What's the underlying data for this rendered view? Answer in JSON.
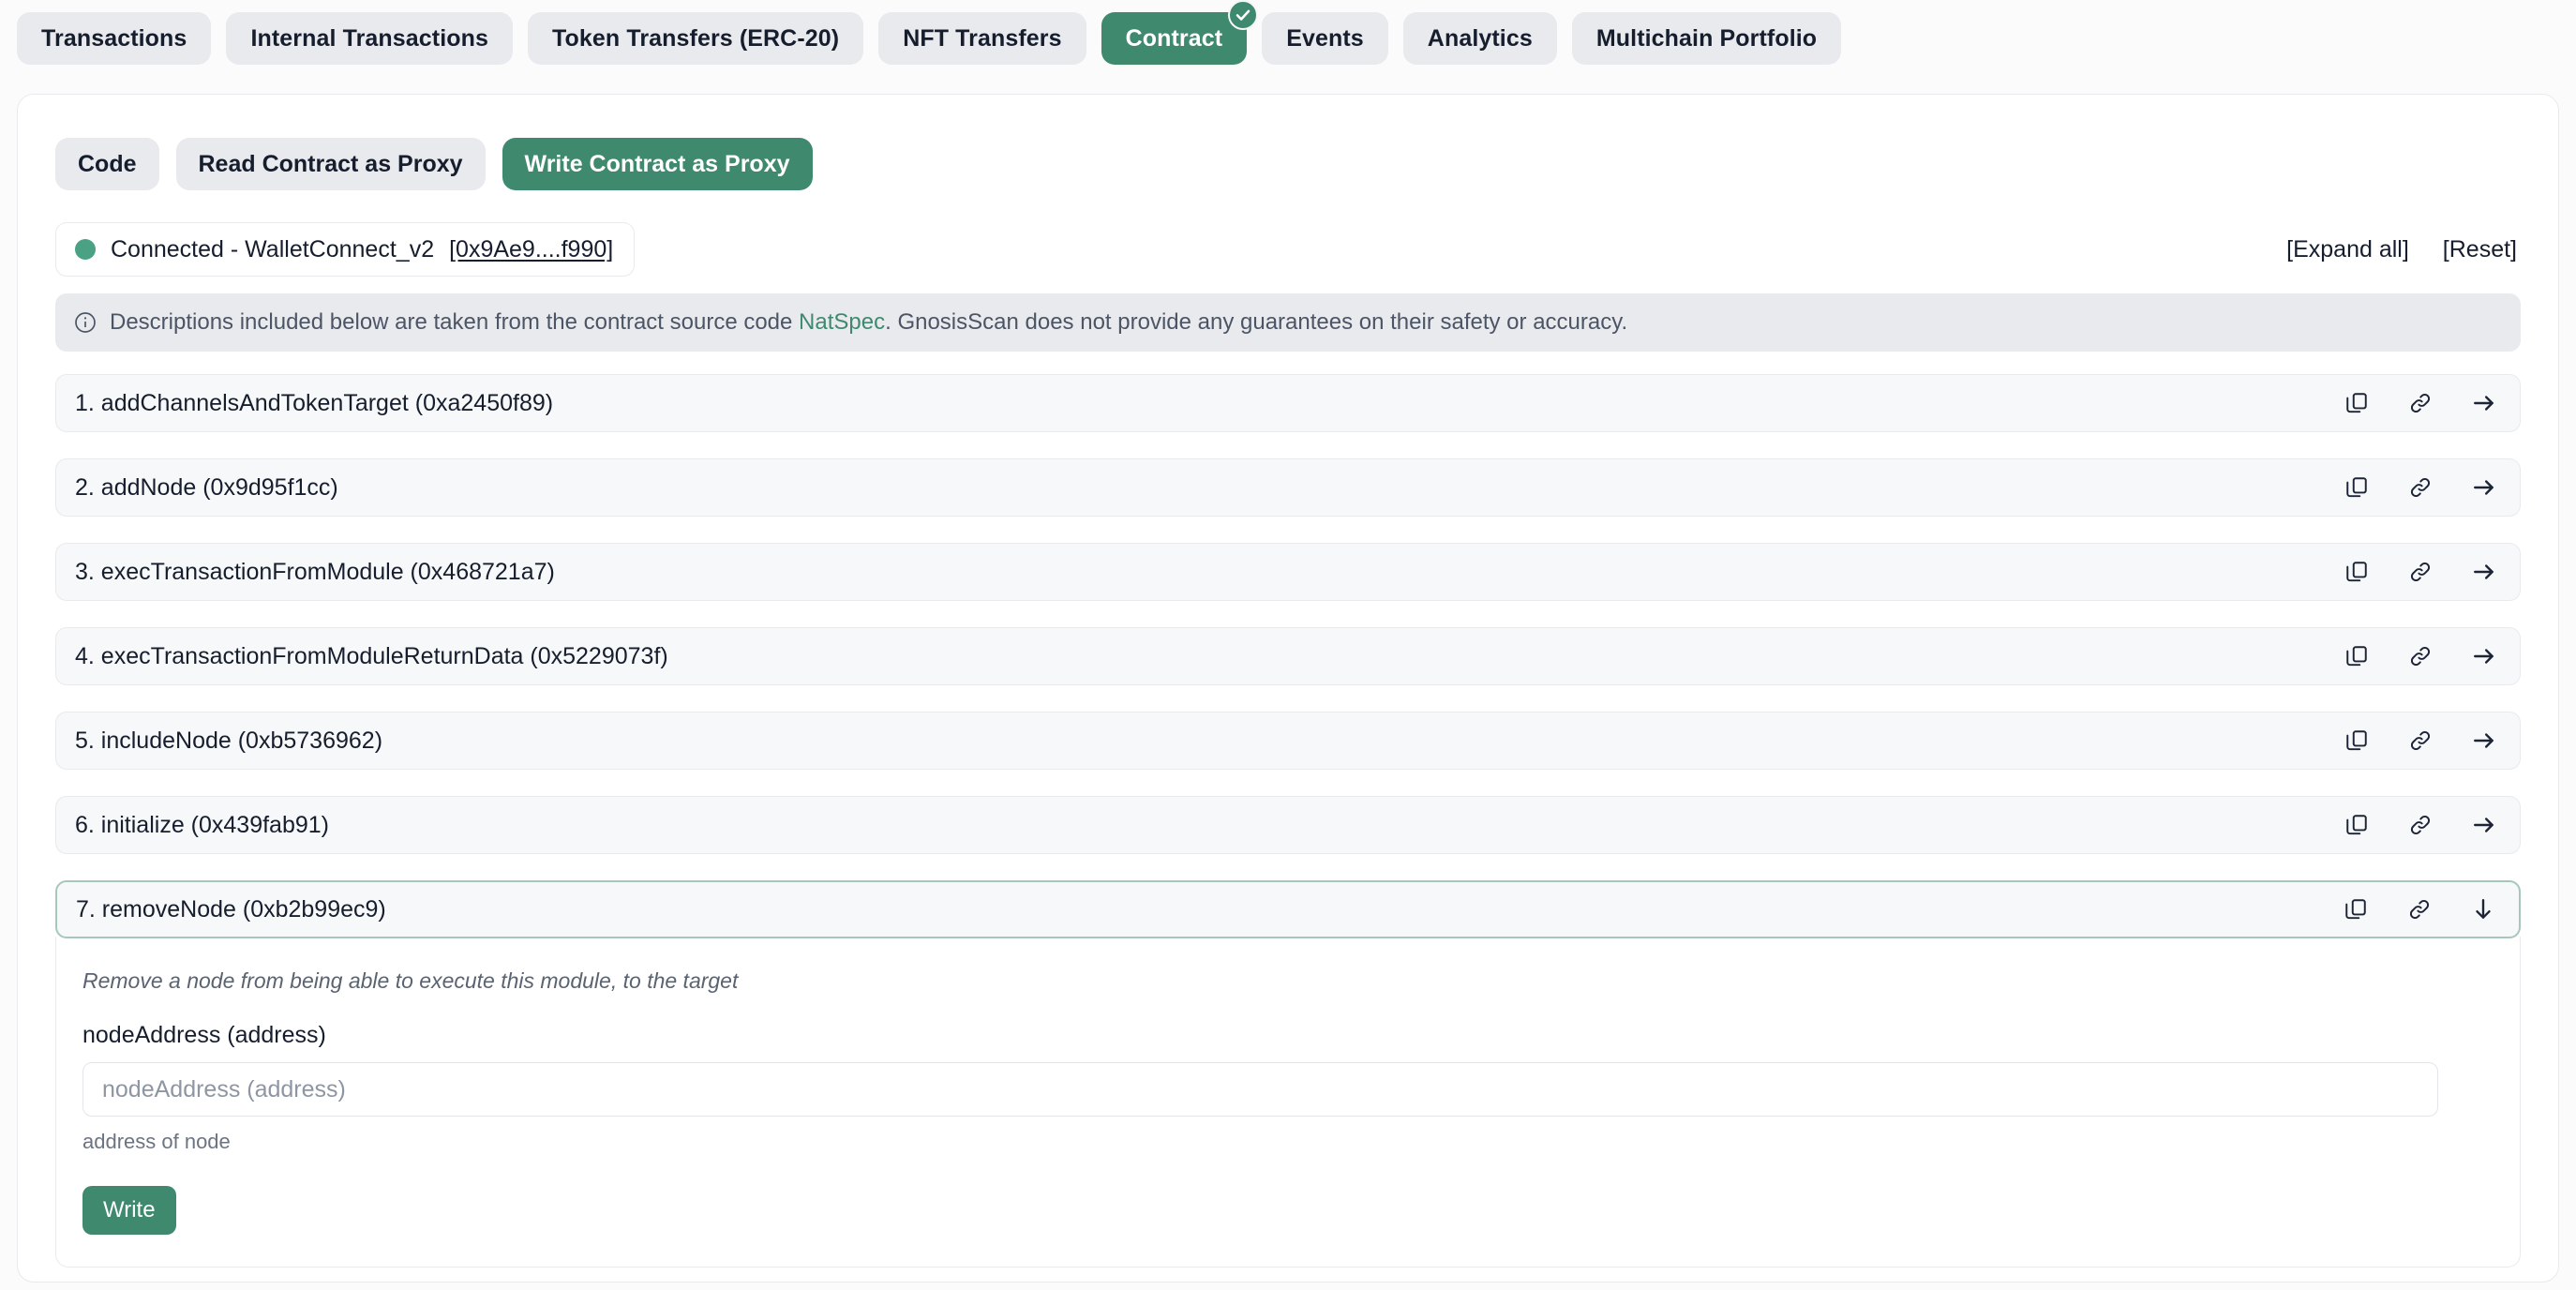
{
  "top_tabs": [
    {
      "label": "Transactions",
      "active": false,
      "badge": false
    },
    {
      "label": "Internal Transactions",
      "active": false,
      "badge": false
    },
    {
      "label": "Token Transfers (ERC-20)",
      "active": false,
      "badge": false
    },
    {
      "label": "NFT Transfers",
      "active": false,
      "badge": false
    },
    {
      "label": "Contract",
      "active": true,
      "badge": true
    },
    {
      "label": "Events",
      "active": false,
      "badge": false
    },
    {
      "label": "Analytics",
      "active": false,
      "badge": false
    },
    {
      "label": "Multichain Portfolio",
      "active": false,
      "badge": false
    }
  ],
  "sub_tabs": [
    {
      "label": "Code",
      "active": false
    },
    {
      "label": "Read Contract as Proxy",
      "active": false
    },
    {
      "label": "Write Contract as Proxy",
      "active": true
    }
  ],
  "wallet": {
    "status_text": "Connected - WalletConnect_v2",
    "address": "[0x9Ae9....f990]",
    "expand_all": "[Expand all]",
    "reset": "[Reset]"
  },
  "notice": {
    "text_before": "Descriptions included below are taken from the contract source code ",
    "link": "NatSpec",
    "text_after": ". GnosisScan does not provide any guarantees on their safety or accuracy."
  },
  "functions": [
    {
      "label": "1. addChannelsAndTokenTarget (0xa2450f89)",
      "expanded": false
    },
    {
      "label": "2. addNode (0x9d95f1cc)",
      "expanded": false
    },
    {
      "label": "3. execTransactionFromModule (0x468721a7)",
      "expanded": false
    },
    {
      "label": "4. execTransactionFromModuleReturnData (0x5229073f)",
      "expanded": false
    },
    {
      "label": "5. includeNode (0xb5736962)",
      "expanded": false
    },
    {
      "label": "6. initialize (0x439fab91)",
      "expanded": false
    },
    {
      "label": "7. removeNode (0xb2b99ec9)",
      "expanded": true
    }
  ],
  "expanded_form": {
    "description": "Remove a node from being able to execute this module, to the target",
    "field_label": "nodeAddress (address)",
    "field_value": "",
    "field_placeholder": "nodeAddress (address)",
    "field_hint": "address of node",
    "submit_label": "Write"
  },
  "icons": {
    "copy": "copy-icon",
    "link": "link-icon",
    "arrow_right": "arrow-right-icon",
    "arrow_down": "arrow-down-icon",
    "info": "info-icon",
    "check": "check-icon"
  },
  "colors": {
    "accent_green": "#3f8a6e",
    "status_dot": "#4aa184",
    "tab_inactive_bg": "#e9eaee",
    "text_dark": "#161e2e",
    "expanded_border": "#a6c8ba"
  }
}
